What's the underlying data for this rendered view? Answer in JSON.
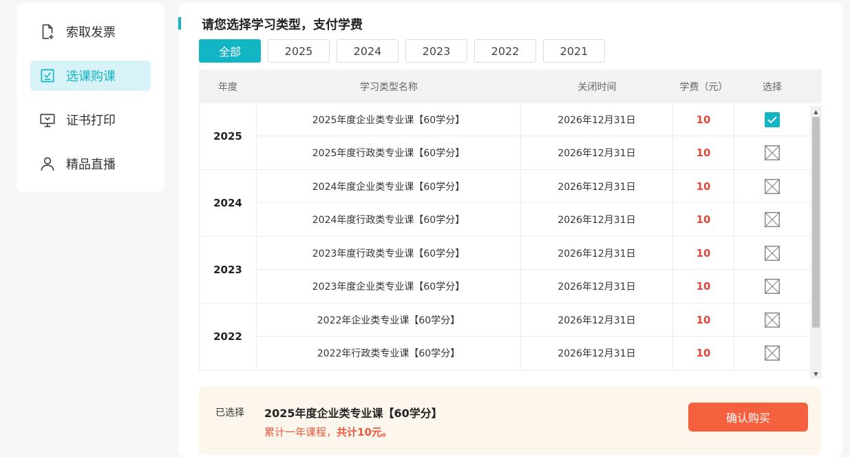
{
  "sidebar": {
    "items": [
      {
        "label": "索取发票",
        "icon": "file-plus-icon",
        "active": false
      },
      {
        "label": "选课购课",
        "icon": "checklist-icon",
        "active": true
      },
      {
        "label": "证书打印",
        "icon": "monitor-icon",
        "active": false
      },
      {
        "label": "精品直播",
        "icon": "user-icon",
        "active": false
      }
    ]
  },
  "main": {
    "title": "请您选择学习类型，支付学费",
    "tabs": [
      {
        "label": "全部",
        "active": true
      },
      {
        "label": "2025",
        "active": false
      },
      {
        "label": "2024",
        "active": false
      },
      {
        "label": "2023",
        "active": false
      },
      {
        "label": "2022",
        "active": false
      },
      {
        "label": "2021",
        "active": false
      }
    ],
    "table": {
      "headers": {
        "year": "年度",
        "name": "学习类型名称",
        "close": "关闭时间",
        "fee": "学费（元）",
        "select": "选择"
      },
      "groups": [
        {
          "year": "2025",
          "rows": [
            {
              "name": "2025年度企业类专业课【60学分】",
              "close": "2026年12月31日",
              "fee": "10",
              "checked": true
            },
            {
              "name": "2025年度行政类专业课【60学分】",
              "close": "2026年12月31日",
              "fee": "10",
              "checked": false
            }
          ]
        },
        {
          "year": "2024",
          "rows": [
            {
              "name": "2024年度企业类专业课【60学分】",
              "close": "2026年12月31日",
              "fee": "10",
              "checked": false
            },
            {
              "name": "2024年度行政类专业课【60学分】",
              "close": "2026年12月31日",
              "fee": "10",
              "checked": false
            }
          ]
        },
        {
          "year": "2023",
          "rows": [
            {
              "name": "2023年度行政类专业课【60学分】",
              "close": "2026年12月31日",
              "fee": "10",
              "checked": false
            },
            {
              "name": "2023年度企业类专业课【60学分】",
              "close": "2026年12月31日",
              "fee": "10",
              "checked": false
            }
          ]
        },
        {
          "year": "2022",
          "rows": [
            {
              "name": "2022年企业类专业课【60学分】",
              "close": "2026年12月31日",
              "fee": "10",
              "checked": false
            },
            {
              "name": "2022年行政类专业课【60学分】",
              "close": "2026年12月31日",
              "fee": "10",
              "checked": false
            }
          ]
        }
      ]
    }
  },
  "footer": {
    "selected_label": "已选择",
    "selected_course": "2025年度企业类专业课【60学分】",
    "summary_prefix": "累计一年课程，",
    "summary_total": "共计10元。",
    "confirm_label": "确认购买"
  },
  "colors": {
    "accent": "#12b5c4",
    "fee": "#e5463a",
    "confirm": "#f5603e",
    "footer_bg": "#fdf6ec"
  }
}
